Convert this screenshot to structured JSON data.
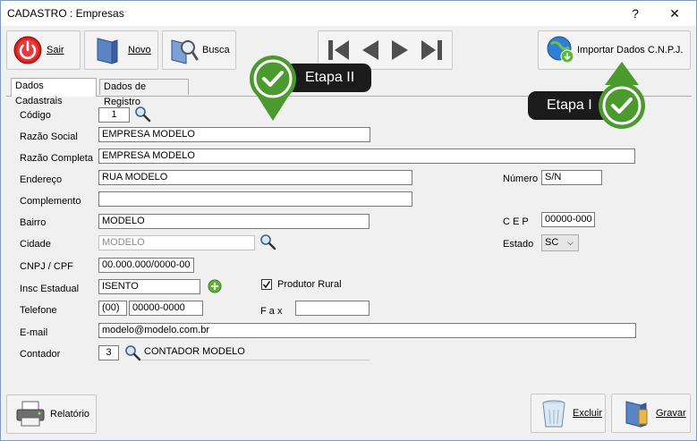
{
  "window": {
    "title": "CADASTRO : Empresas",
    "help": "?",
    "close": "✕"
  },
  "toolbar": {
    "sair": "Sair",
    "novo": "Novo",
    "busca": "Busca",
    "importar": "Importar Dados C.N.P.J."
  },
  "tabs": {
    "cadastrais": "Dados Cadastrais",
    "registro": "Dados de Registro"
  },
  "callouts": {
    "etapa2": "Etapa II",
    "etapa1": "Etapa I"
  },
  "form": {
    "codigo": {
      "label": "Código",
      "value": "1"
    },
    "razao_social": {
      "label": "Razão Social",
      "value": "EMPRESA MODELO"
    },
    "razao_completa": {
      "label": "Razão Completa",
      "value": "EMPRESA MODELO"
    },
    "endereco": {
      "label": "Endereço",
      "value": "RUA MODELO"
    },
    "numero": {
      "label": "Número",
      "value": "S/N"
    },
    "complemento": {
      "label": "Complemento",
      "value": ""
    },
    "bairro": {
      "label": "Bairro",
      "value": "MODELO"
    },
    "cep": {
      "label": "C E P",
      "value": "00000-000"
    },
    "cidade": {
      "label": "Cidade",
      "value": "MODELO"
    },
    "estado": {
      "label": "Estado",
      "value": "SC"
    },
    "cnpj": {
      "label": "CNPJ / CPF",
      "value": "00.000.000/0000-00"
    },
    "insc": {
      "label": "Insc Estadual",
      "value": "ISENTO"
    },
    "produtor": {
      "label": "Produtor Rural",
      "checked": true
    },
    "telefone": {
      "label": "Telefone",
      "ddd": "(00)",
      "value": "00000-0000"
    },
    "fax": {
      "label": "F a x",
      "value": ""
    },
    "email": {
      "label": "E-mail",
      "value": "modelo@modelo.com.br"
    },
    "contador": {
      "label": "Contador",
      "code": "3",
      "name": "CONTADOR MODELO"
    }
  },
  "footer": {
    "relatorio": "Relatório",
    "excluir": "Excluir",
    "gravar": "Gravar"
  }
}
